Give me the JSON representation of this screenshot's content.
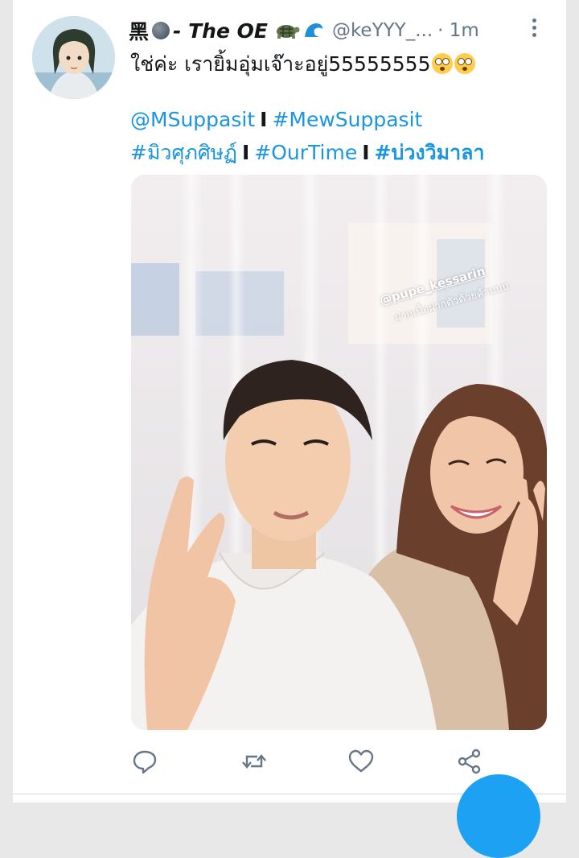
{
  "tweet": {
    "author": {
      "name_prefix": "黑",
      "name_main": "- The OE",
      "handle": "@keYYY_...",
      "separator": "·",
      "time": "1m"
    },
    "text": "ใช่ค่ะ เรายิ้มอุ่มเจ๊าะอยู่55555555",
    "tags_line1": [
      "@MSuppasit",
      "#MewSuppasit"
    ],
    "tags_line2": [
      "#มิวศุภศิษฏ์",
      "#OurTime",
      "#บ่วงวิมาลา"
    ],
    "tag_separator": "I",
    "media": {
      "overlay_mention": "@pupe_kessarin",
      "overlay_caption": "ฝากเนื้อฝากตัวด้วยค้าบบบ"
    }
  },
  "actions": {
    "reply": "reply-icon",
    "retweet": "retweet-icon",
    "like": "heart-icon",
    "share": "share-icon"
  },
  "colors": {
    "link": "#1b95e0",
    "muted": "#657786",
    "accent": "#1da1f2"
  }
}
